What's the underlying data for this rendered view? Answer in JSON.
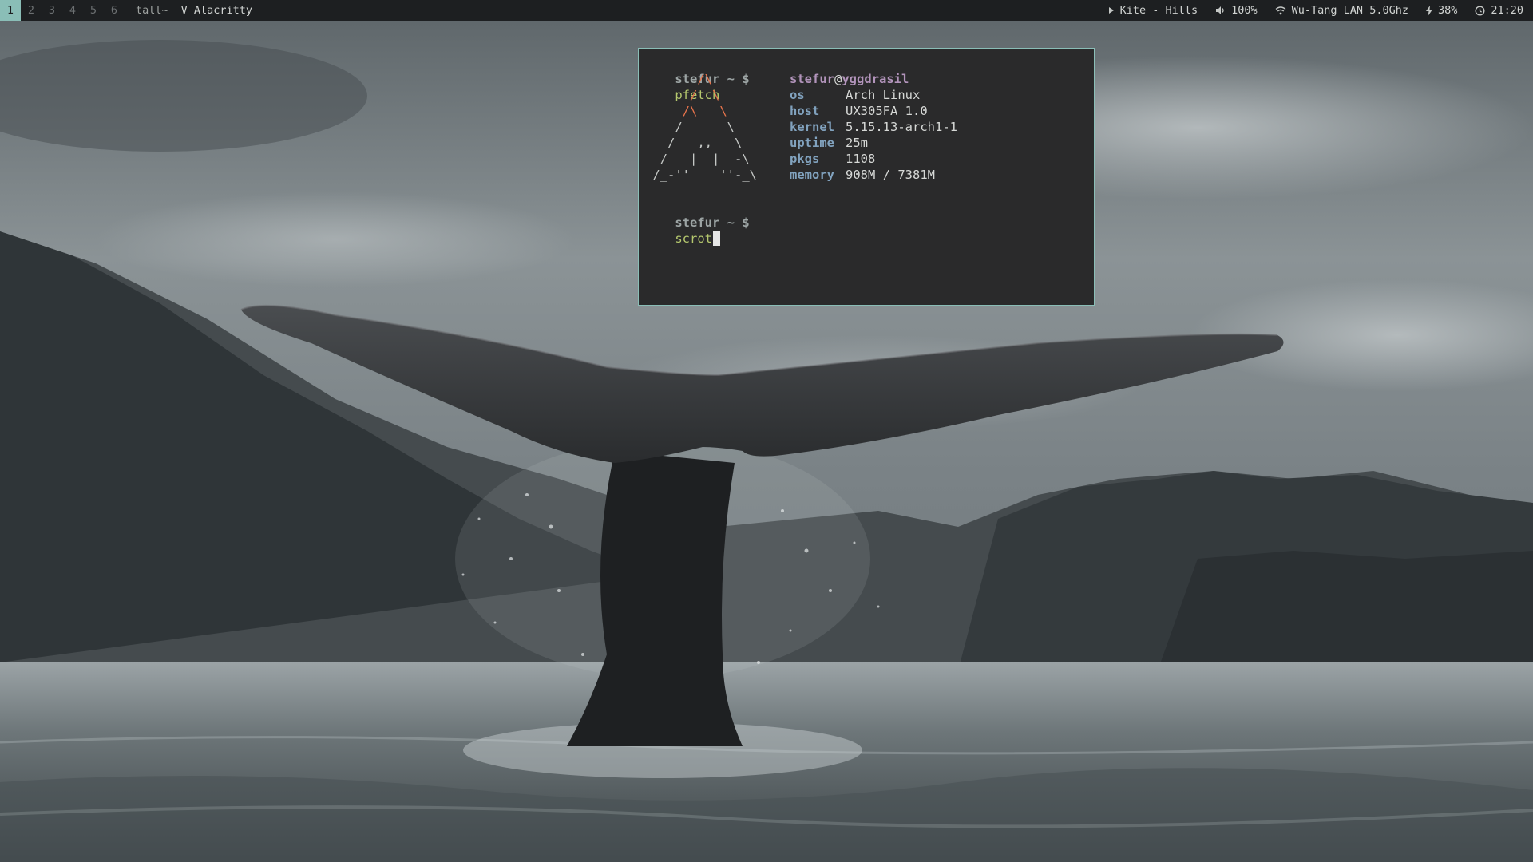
{
  "topbar": {
    "workspaces": [
      "1",
      "2",
      "3",
      "4",
      "5",
      "6"
    ],
    "active_workspace": "1",
    "layout": "tall~",
    "window_title": "V Alacritty",
    "music": "Kite - Hills",
    "volume": "100%",
    "wifi": "Wu-Tang LAN 5.0Ghz",
    "battery": "38%",
    "clock": "21:20"
  },
  "terminal": {
    "prompt": "stefur ~ $",
    "command1": "pfetch",
    "command2": "scrot",
    "ascii_art": [
      "       /\\",
      "      /  \\",
      "     /\\   \\",
      "    /      \\",
      "   /   ,,   \\",
      "  /   |  |  -\\",
      " /_-''    ''-_\\"
    ],
    "user": "stefur",
    "at": "@",
    "hostname": "yggdrasil",
    "info": [
      {
        "key": "os",
        "value": "Arch Linux"
      },
      {
        "key": "host",
        "value": "UX305FA 1.0"
      },
      {
        "key": "kernel",
        "value": "5.15.13-arch1-1"
      },
      {
        "key": "uptime",
        "value": "25m"
      },
      {
        "key": "pkgs",
        "value": "1108"
      },
      {
        "key": "memory",
        "value": "908M / 7381M"
      }
    ]
  },
  "colors": {
    "accent": "#8abeb7",
    "bar_bg": "#1d1f21",
    "terminal_bg": "#2a2a2b",
    "info_key": "#81a2be",
    "user": "#b294bb",
    "command": "#b5c86e",
    "arch_orange": "#e8744c"
  }
}
